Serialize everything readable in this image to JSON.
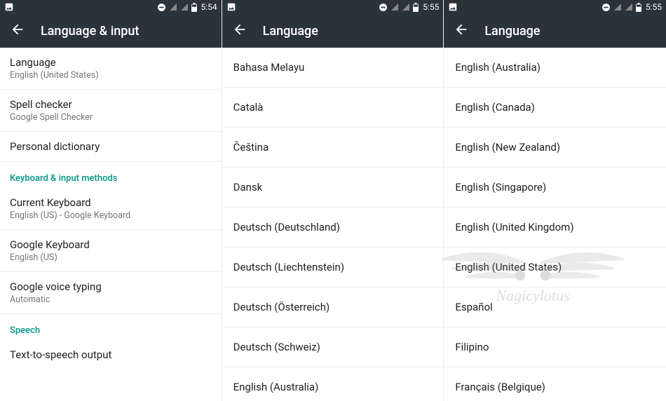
{
  "screen1": {
    "status_time": "5:54",
    "title": "Language & input",
    "rows": [
      {
        "primary": "Language",
        "secondary": "English (United States)"
      },
      {
        "primary": "Spell checker",
        "secondary": "Google Spell Checker"
      },
      {
        "primary": "Personal dictionary",
        "secondary": null
      }
    ],
    "section1_header": "Keyboard & input methods",
    "section1_rows": [
      {
        "primary": "Current Keyboard",
        "secondary": "English (US) - Google Keyboard"
      },
      {
        "primary": "Google Keyboard",
        "secondary": "English (US)"
      },
      {
        "primary": "Google voice typing",
        "secondary": "Automatic"
      }
    ],
    "section2_header": "Speech",
    "section2_rows": [
      {
        "primary": "Text-to-speech output",
        "secondary": null
      }
    ]
  },
  "screen2": {
    "status_time": "5:55",
    "title": "Language",
    "languages": [
      "Bahasa Melayu",
      "Català",
      "Čeština",
      "Dansk",
      "Deutsch (Deutschland)",
      "Deutsch (Liechtenstein)",
      "Deutsch (Österreich)",
      "Deutsch (Schweiz)",
      "English (Australia)"
    ]
  },
  "screen3": {
    "status_time": "5:55",
    "title": "Language",
    "languages": [
      "English (Australia)",
      "English (Canada)",
      "English (New Zealand)",
      "English (Singapore)",
      "English (United Kingdom)",
      "English (United States)",
      "Español",
      "Filipino",
      "Français (Belgique)"
    ]
  },
  "watermark_text": "Nagicylotus"
}
